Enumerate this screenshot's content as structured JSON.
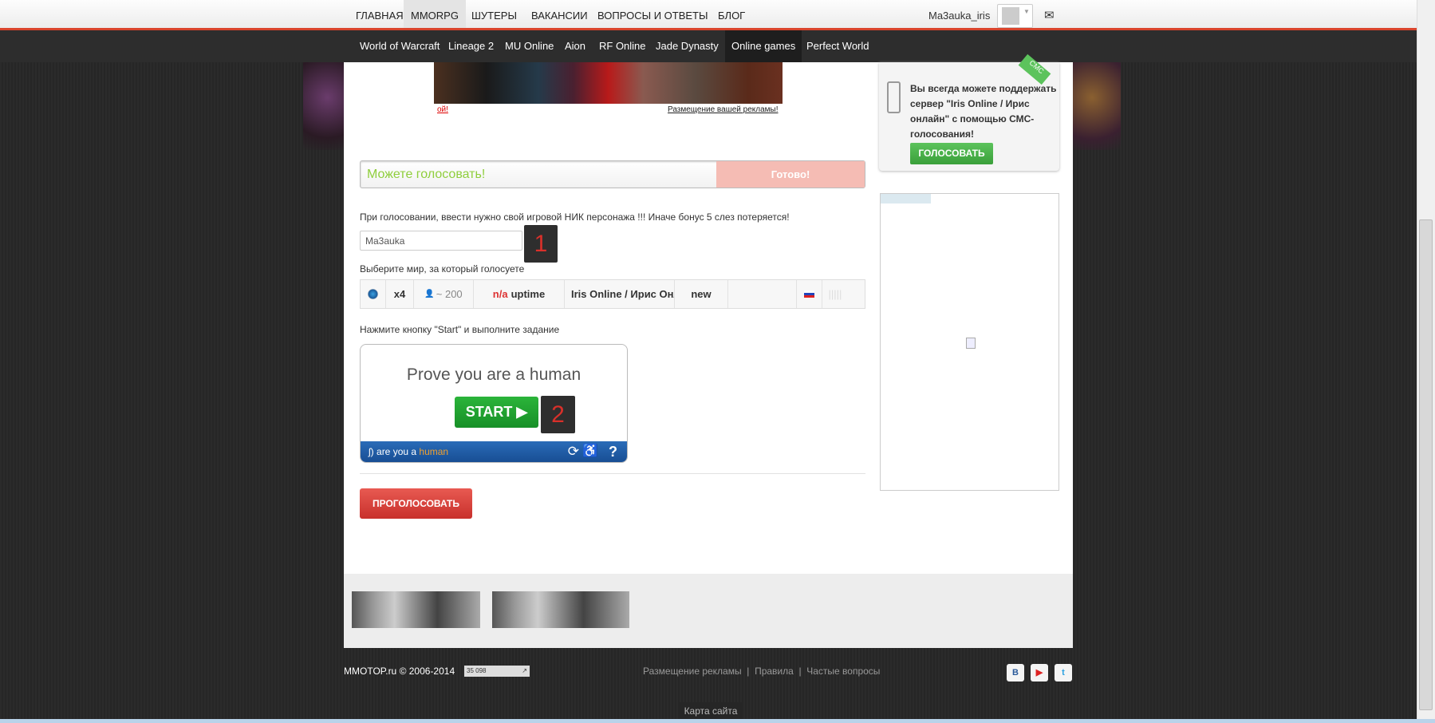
{
  "top_nav": {
    "items": [
      "ГЛАВНАЯ",
      "MMORPG",
      "ШУТЕРЫ",
      "ВАКАНСИИ",
      "ВОПРОСЫ И ОТВЕТЫ",
      "БЛОГ"
    ],
    "active": "MMORPG",
    "username": "Ma3auka_iris"
  },
  "sub_nav": {
    "items": [
      "World of Warcraft",
      "Lineage 2",
      "MU Online",
      "Aion",
      "RF Online",
      "Jade Dynasty",
      "Online games",
      "Perfect World"
    ],
    "active": "Online games"
  },
  "banner": {
    "left_link": "ой!",
    "right_link": "Размещение вашей рекламы!"
  },
  "vote_status": {
    "message": "Можете голосовать!",
    "ready": "Готово!"
  },
  "form": {
    "nick_hint": "При голосовании, ввести нужно свой игровой НИК персонажа !!! Иначе бонус 5 слез потеряется!",
    "nick_value": "Ma3auka",
    "badge1": "1",
    "world_label": "Выберите мир, за который голосуете",
    "server": {
      "rate": "x4",
      "players": "~ 200",
      "uptime_na": "n/a",
      "uptime": "uptime",
      "name": "Iris Online / Ирис Онлайн",
      "status": "new",
      "selected": true
    },
    "start_hint": "Нажмите кнопку \"Start\" и выполните задание",
    "vote_button": "ПРОГОЛОСОВАТЬ"
  },
  "captcha": {
    "title": "Prove you are a human",
    "start": "START",
    "badge2": "2",
    "brand_prefix": "are you a",
    "brand_suffix": "human"
  },
  "sidebar": {
    "sms_ribbon": "СМС",
    "sms_text": "Вы всегда можете поддержать сервер \"Iris Online / Ирис онлайн\" с помощью СМС-голосования!",
    "sms_button": "ГОЛОСОВАТЬ"
  },
  "footer": {
    "copyright": "MMOTOP.ru © 2006-2014",
    "counter": "35 098",
    "links": [
      "Размещение рекламы",
      "Правила",
      "Частые вопросы"
    ],
    "sitemap": "Карта сайта",
    "social": [
      "В",
      "▶",
      "t"
    ]
  },
  "colors": {
    "accent_red": "#d9442c",
    "vote_green": "#8fce3c",
    "start_green": "#1fa22f",
    "vote_button": "#d8403a"
  }
}
